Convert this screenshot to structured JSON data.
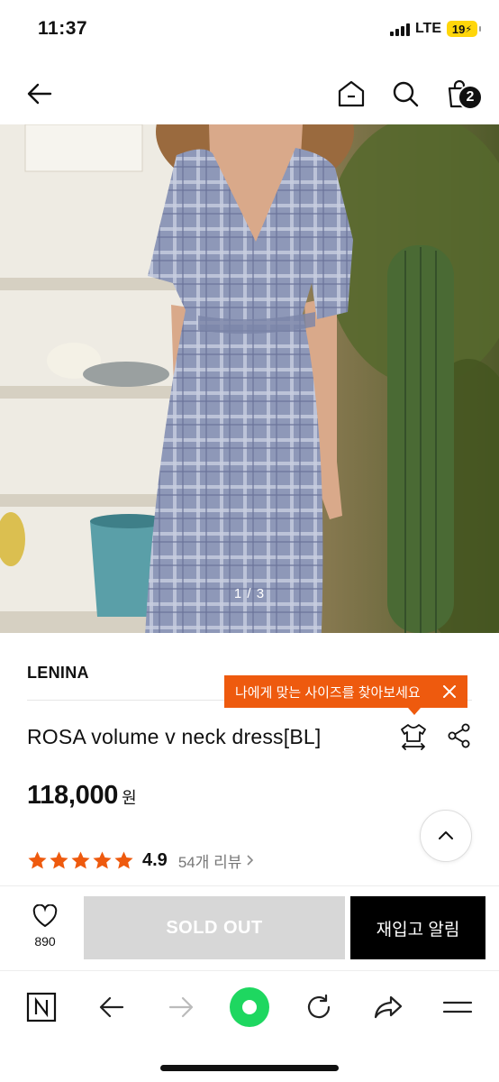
{
  "status_bar": {
    "time": "11:37",
    "network": "LTE",
    "battery": "19"
  },
  "nav": {
    "cart_count": "2"
  },
  "gallery": {
    "counter": "1 / 3"
  },
  "product": {
    "brand": "LENINA",
    "name": "ROSA volume v neck dress[BL]",
    "price": "118,000",
    "currency": "원",
    "rating": {
      "score": "4.9",
      "stars": 5,
      "review_label": "54개 리뷰"
    }
  },
  "size_tooltip": {
    "text": "나에게 맞는 사이즈를 찾아보세요"
  },
  "actions": {
    "wish_count": "890",
    "soldout_label": "SOLD OUT",
    "restock_label": "재입고 알림"
  },
  "colors": {
    "accent": "#ee5a0e",
    "soldout_bg": "#d7d7d7",
    "primary_bg": "#000000",
    "browser_green": "#1ed760"
  }
}
